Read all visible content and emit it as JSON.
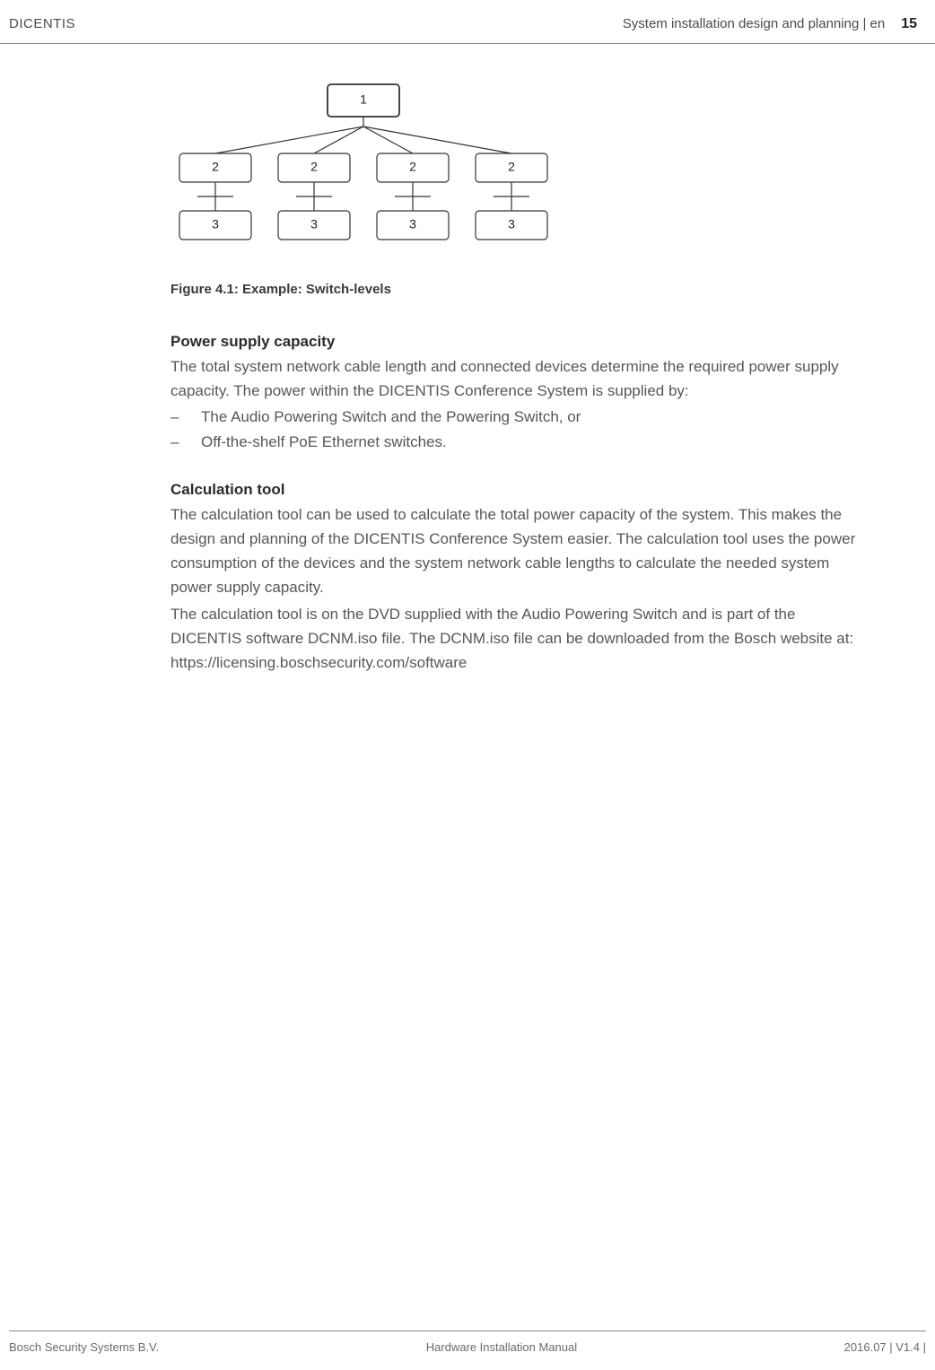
{
  "header": {
    "left": "DICENTIS",
    "right_section": "System installation design and planning | en",
    "page_number": "15"
  },
  "diagram": {
    "root_label": "1",
    "level2_labels": [
      "2",
      "2",
      "2",
      "2"
    ],
    "level3_labels": [
      "3",
      "3",
      "3",
      "3"
    ]
  },
  "figure_caption": "Figure 4.1: Example: Switch-levels",
  "sections": {
    "power": {
      "title": "Power supply capacity",
      "para": "The total system network cable length and connected devices determine the required power supply capacity. The power within the DICENTIS Conference System is supplied by:",
      "bullets": [
        "The Audio Powering Switch and the Powering Switch, or",
        "Off-the-shelf PoE Ethernet switches."
      ]
    },
    "calc": {
      "title": "Calculation tool",
      "para1": "The calculation tool can be used to calculate the total power capacity of the system. This makes the design and planning of the DICENTIS Conference System easier. The calculation tool uses the power consumption of the devices and the system network cable lengths to calculate the needed system power supply capacity.",
      "para2": "The calculation tool is on the DVD supplied with the Audio Powering Switch and is part of the DICENTIS software DCNM.iso file. The DCNM.iso file can be downloaded from the Bosch website at: https://licensing.boschsecurity.com/software"
    }
  },
  "footer": {
    "left": "Bosch Security Systems B.V.",
    "center": "Hardware Installation Manual",
    "right": "2016.07 | V1.4 |"
  }
}
